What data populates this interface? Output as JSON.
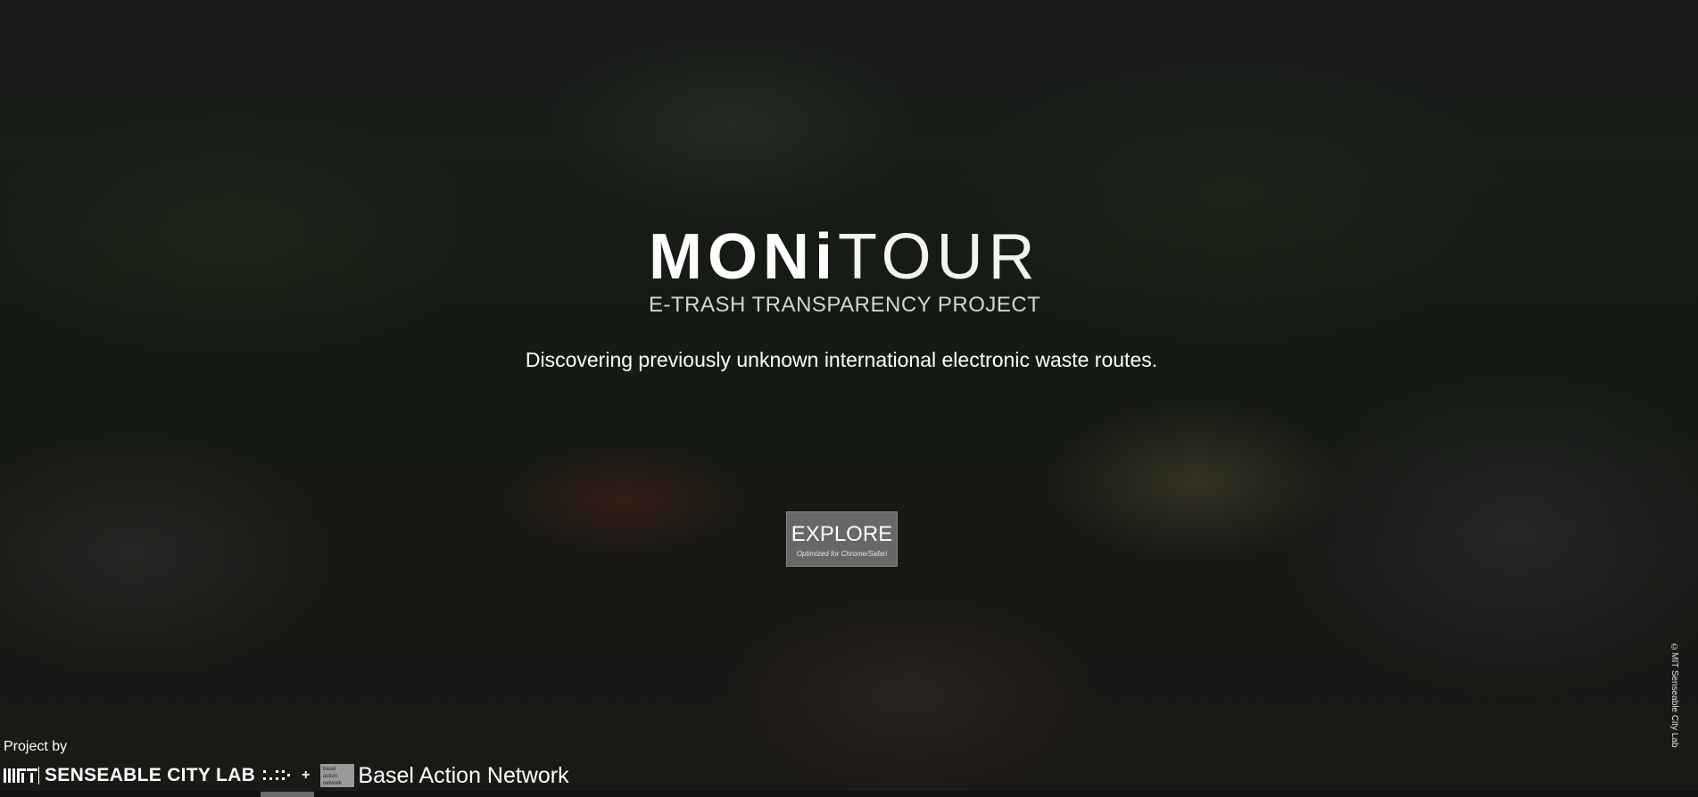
{
  "brand": {
    "title_bold": "MONi",
    "title_light": "TOUR",
    "subtitle": "E-TRASH TRANSPARENCY PROJECT"
  },
  "hero": {
    "tagline": "Discovering previously unknown international electronic waste routes.",
    "explore_label": "EXPLORE",
    "explore_note": "Optimized for Chrome/Safari"
  },
  "credits": {
    "project_by": "Project by",
    "partner1": "SENSEABLE CITY LAB",
    "plus": "+",
    "partner2_logo_text": "basel action network",
    "partner2": "Basel Action Network"
  },
  "copyright": "©MIT Senseable City Lab",
  "icons": {
    "mit": "mit-logo",
    "scl_dots": "senseable-dots-logo",
    "ban": "basel-action-network-logo"
  }
}
